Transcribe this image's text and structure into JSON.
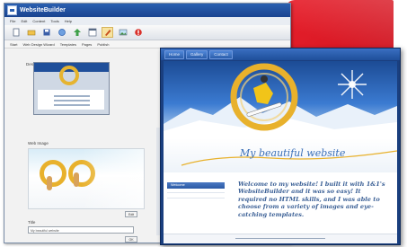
{
  "app": {
    "title": "WebsiteBuilder",
    "menu": [
      "File",
      "Edit",
      "Content",
      "Tools",
      "Help"
    ],
    "toolbar": [
      "new-icon",
      "open-icon",
      "save-icon",
      "preview-icon",
      "publish-icon",
      "layout-icon",
      "design-icon",
      "images-icon",
      "help-icon"
    ],
    "tabs": [
      "Start",
      "Web Design Wizard",
      "Templates",
      "Pages",
      "Publish"
    ],
    "design_label": "Design",
    "images_label": "Web Image",
    "choose_button": "Edit",
    "field_label": "Title",
    "field_value": "My beautiful website",
    "apply_button": "OK"
  },
  "preview": {
    "nav_tabs": [
      "Home",
      "Gallery",
      "Contact"
    ],
    "site_title": "My beautiful website",
    "sidebar_item": "Welcome",
    "welcome_text": "Welcome to my website! I built it with 1&1's WebsiteBuilder and it was so easy! It required no HTML skills, and I was able to choose from a variety of images and eye-catching templates."
  },
  "colors": {
    "accent_red": "#e8202c",
    "window_blue": "#1a3f7f",
    "title_blue": "#3a6fb8",
    "ring_gold": "#e8b12c"
  }
}
